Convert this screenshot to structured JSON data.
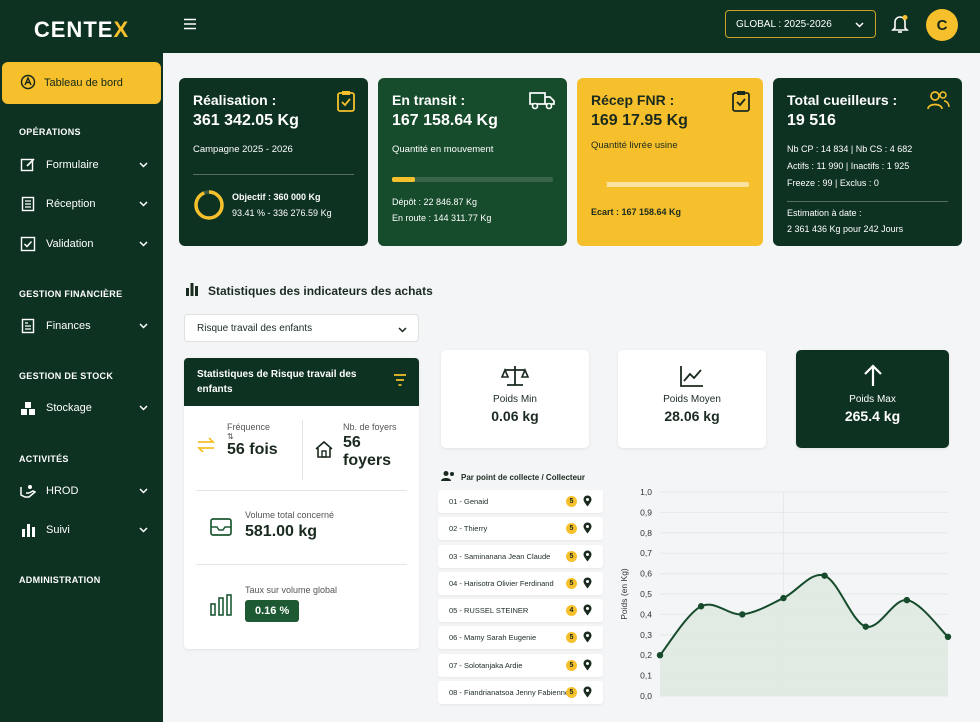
{
  "brand": {
    "name_a": "CENTE",
    "name_b": "X"
  },
  "sidebar": {
    "active": "Tableau de bord",
    "sections": {
      "operations": "OPÉRATIONS",
      "finance": "GESTION FINANCIÈRE",
      "stock": "GESTION DE STOCK",
      "activites": "ACTIVITÉS",
      "admin": "ADMINISTRATION"
    },
    "items": [
      "Formulaire",
      "Réception",
      "Validation",
      "Finances",
      "Stockage",
      "HROD",
      "Suivi"
    ]
  },
  "topbar": {
    "global": "GLOBAL : 2025-2026",
    "avatar": "C"
  },
  "kpis": {
    "realisation": {
      "title": "Réalisation :",
      "value": "361 342.05 Kg",
      "sub": "Campagne 2025 - 2026",
      "objectif": "Objectif : 360 000 Kg",
      "pct": "93.41 % - 336 276.59 Kg",
      "progress": 0.9341
    },
    "transit": {
      "title": "En transit :",
      "value": "167 158.64 Kg",
      "sub": "Quantité en mouvement",
      "depot": "Dépôt : 22 846.87 Kg",
      "route": "En route : 144 311.77 Kg",
      "progress": 0.14
    },
    "fnr": {
      "title": "Récep FNR :",
      "value": "169 17.95 Kg",
      "sub": "Quantité livrée usine",
      "ecart": "Ecart : 167 158.64 Kg",
      "progress": 0.1
    },
    "cueilleurs": {
      "title": "Total cueilleurs :",
      "value": "19 516",
      "l1": "Nb CP : 14 834 | Nb CS : 4 682",
      "l2": "Actifs : 11 990 | Inactifs : 1 925",
      "l3": "Freeze : 99 | Exclus : 0",
      "l4": "Estimation à date :",
      "l5": "2 361 436 Kg pour 242 Jours"
    }
  },
  "stats": {
    "title": "Statistiques des indicateurs des achats",
    "select": "Risque travail des enfants",
    "risk_title": "Statistiques de Risque travail des enfants",
    "freq_label": "Fréquence",
    "freq_value": "56 fois",
    "foyers_label": "Nb. de foyers",
    "foyers_value_a": "56",
    "foyers_value_b": "foyers",
    "volume_label": "Volume total concerné",
    "volume_value": "581.00 kg",
    "taux_label": "Taux sur volume global",
    "taux_value": "0.16 %"
  },
  "weights": {
    "min": {
      "label": "Poids Min",
      "value": "0.06 kg"
    },
    "avg": {
      "label": "Poids Moyen",
      "value": "28.06 kg"
    },
    "max": {
      "label": "Poids Max",
      "value": "265.4 kg"
    }
  },
  "collecteurs": {
    "title": "Par point de collecte / Collecteur",
    "items": [
      {
        "name": "01 - Genaid",
        "badge": "5"
      },
      {
        "name": "02 - Thierry",
        "badge": "5"
      },
      {
        "name": "03 - Saminanana Jean Claude",
        "badge": "5"
      },
      {
        "name": "04 - Harisotra Olivier Ferdinand",
        "badge": "5"
      },
      {
        "name": "05 - RUSSEL STEINER",
        "badge": "4"
      },
      {
        "name": "06 - Mamy Sarah Eugenie",
        "badge": "5"
      },
      {
        "name": "07 - Solotanjaka Ardie",
        "badge": "5"
      },
      {
        "name": "08 - Fiandrianatsoa Jenny Fabienne",
        "badge": "5"
      }
    ]
  },
  "chart_data": {
    "type": "area",
    "ylabel": "Poids (en Kg)",
    "ylim": [
      0,
      1
    ],
    "yticks": [
      "0,0",
      "0,1",
      "0,2",
      "0,3",
      "0,4",
      "0,5",
      "0,6",
      "0,7",
      "0,8",
      "0,9",
      "1,0"
    ],
    "x": [
      1,
      2,
      3,
      4,
      5,
      6,
      7,
      8
    ],
    "values": [
      0.2,
      0.44,
      0.4,
      0.48,
      0.59,
      0.34,
      0.47,
      0.29
    ],
    "colors": {
      "line": "#164b2c",
      "fill": "#dde8df"
    }
  }
}
